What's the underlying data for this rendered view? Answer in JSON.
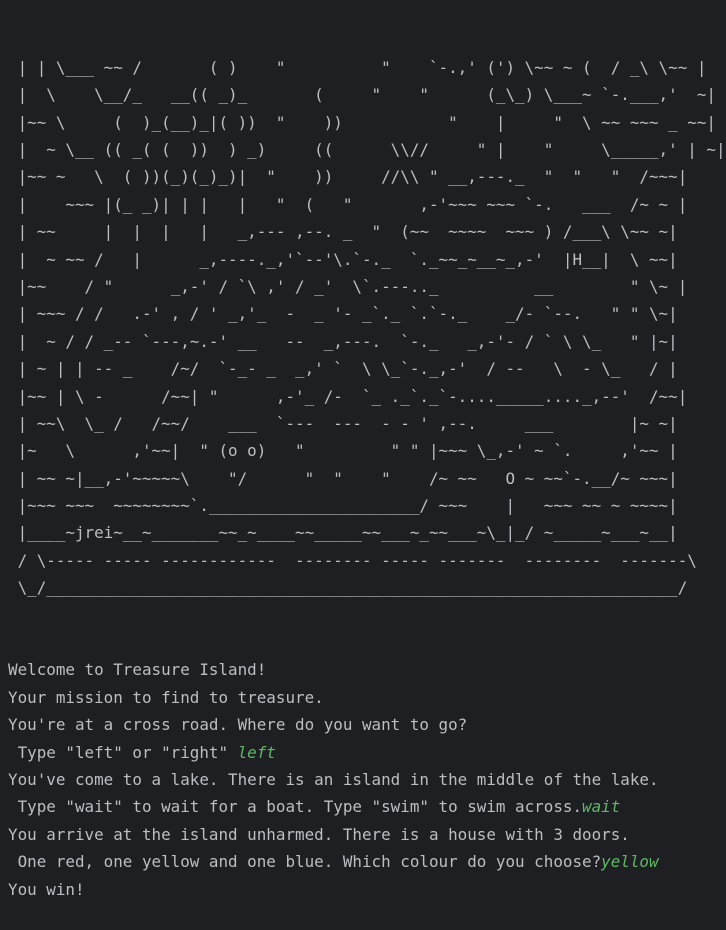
{
  "art_lines": [
    " | | \\___ ~~ /       ( )    \"          \"    `-.,' (') \\~~ ~ (  / _\\ \\~~ |",
    " |  \\    \\__/_   __(( _)_       (     \"    \"      (_\\_) \\___~ `-.___,'  ~|",
    " |~~ \\     (  )_(__)_|( ))  \"    ))           \"    |     \"  \\ ~~ ~~~ _ ~~|",
    " |  ~ \\__ (( _( (  ))  ) _)     ((      \\\\//     \" |    \"     \\_____,' | ~|",
    " |~~ ~   \\  ( ))(_)(_)_)|  \"    ))     //\\\\ \" __,---._  \"  \"   \"  /~~~|",
    " |    ~~~ |(_ _)| | |   |   \"  (   \"       ,-'~~~ ~~~ `-.   ___  /~ ~ |",
    " | ~~     |  |  |   |   _,--- ,--. _  \"  (~~  ~~~~  ~~~ ) /___\\ \\~~ ~|",
    " |  ~ ~~ /   |      _,----._,'`--'\\.`-._  `._~~_~__~_,-'  |H__|  \\ ~~|",
    " |~~    / \"      _,-' / `\\ ,' / _'  \\`.---.._          __        \" \\~ |",
    " | ~~~ / /   .-' , / ' _,'_  -  _ '- _`._ `.`-._    _/- `--.   \" \" \\~|",
    " |  ~ / / _-- `---,~.-' __   --  _,---.  `-._   _,-'- / ` \\ \\_   \" |~|",
    " | ~ | | -- _    /~/  `-_- _  _,' `  \\ \\_`-._,-'  / --   \\  - \\_   / |",
    " |~~ | \\ -      /~~| \"      ,-'_ /-  `_ ._`._`-...._____...._,--'  /~~|",
    " | ~~\\  \\_ /   /~~/    ___  `---  ---  - - ' ,--.     ___        |~ ~|",
    " |~   \\      ,'~~|  \" (o o)   \"         \" \" |~~~ \\_,-' ~ `.     ,'~~ |",
    " | ~~ ~|__,-'~~~~~\\    \"/      \"  \"    \"    /~ ~~   O ~ ~~`-.__/~ ~~~|",
    " |~~~ ~~~  ~~~~~~~~`.______________________/ ~~~    |   ~~~ ~~ ~ ~~~~|",
    " |____~jrei~__~_______~~_~____~~_____~~___~_~~___~\\_|_/ ~_____~___~__|",
    " / \\----- ----- ------------  -------- ----- -------  --------  -------\\",
    " \\_/__________________________________________________________________/"
  ],
  "output_lines": [
    {
      "text": "Welcome to Treasure Island!",
      "input": ""
    },
    {
      "text": "Your mission to find to treasure.",
      "input": ""
    },
    {
      "text": "You're at a cross road. Where do you want to go?",
      "input": ""
    },
    {
      "text": " Type \"left\" or \"right\" ",
      "input": "left"
    },
    {
      "text": "You've come to a lake. There is an island in the middle of the lake.",
      "input": ""
    },
    {
      "text": " Type \"wait\" to wait for a boat. Type \"swim\" to swim across.",
      "input": "wait"
    },
    {
      "text": "You arrive at the island unharmed. There is a house with 3 doors.",
      "input": ""
    },
    {
      "text": " One red, one yellow and one blue. Which colour do you choose?",
      "input": "yellow"
    },
    {
      "text": "You win!",
      "input": ""
    }
  ],
  "colors": {
    "background": "#1e1f22",
    "text": "#bcbec4",
    "user_input": "#5fb865"
  }
}
